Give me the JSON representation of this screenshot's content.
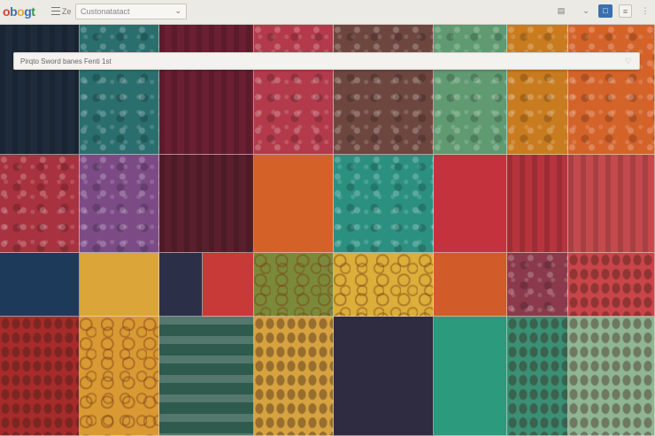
{
  "topbar": {
    "logo_letters": [
      {
        "ch": "o",
        "color": "#d8412f"
      },
      {
        "ch": "b",
        "color": "#3b6ebd"
      },
      {
        "ch": "o",
        "color": "#e9a526"
      },
      {
        "ch": "g",
        "color": "#3b6ebd"
      },
      {
        "ch": "t",
        "color": "#2f9a4c"
      }
    ],
    "label": "Ze",
    "search_text": "Custonatatact",
    "icon_a": "▤",
    "icon_b": "⌄",
    "icon_c": "□",
    "icon_d": "≡",
    "icon_e": "⋮"
  },
  "url_bar": {
    "text": "Pirqto Sword banes Fenti 1st",
    "heart": "♡"
  },
  "mosaic": {
    "tiles": [
      {
        "color": "#1d2b3a",
        "tex": "stripe"
      },
      {
        "color": "#2a6e6e",
        "tex": "speck"
      },
      {
        "color": "#6b1f32",
        "tex": "stripe"
      },
      {
        "color": "#b23a4a",
        "tex": "speck"
      },
      {
        "color": "#6e4640",
        "tex": "speck"
      },
      {
        "color": "#5f9a70",
        "tex": "speck"
      },
      {
        "color": "#c97b1f",
        "tex": "speck"
      },
      {
        "color": "#d4632a",
        "tex": "speck"
      },
      {
        "color": "#a8323f",
        "tex": "speck"
      },
      {
        "color": "#7c4b86",
        "tex": "speck"
      },
      {
        "color": "#5a1f2c",
        "tex": "stripe"
      },
      {
        "color": "#d46127",
        "tex": "none"
      },
      {
        "color": "#2c9081",
        "tex": "speck"
      },
      {
        "color": "#c4323e",
        "tex": "none"
      },
      {
        "color": "#b7343c",
        "tex": "stripe"
      },
      {
        "color": "#c44a4e",
        "tex": "stripe"
      },
      {
        "color": "#1e3a5a",
        "tex": "none"
      },
      {
        "color": "#dba53a",
        "tex": "none"
      },
      {
        "color": "#2c2f48",
        "tex": "none"
      },
      {
        "color": "#c73a38",
        "tex": "none"
      },
      {
        "color": "#7b8a3a",
        "tex": "swirl"
      },
      {
        "color": "#dcae3a",
        "tex": "swirl"
      },
      {
        "color": "#d15c2a",
        "tex": "none"
      },
      {
        "color": "#8a3a4a",
        "tex": "speck"
      },
      {
        "color": "#c8454a",
        "tex": "leaves"
      },
      {
        "color": "#a72b2b",
        "tex": "leaves"
      },
      {
        "color": "#d99a33",
        "tex": "swirl"
      },
      {
        "color": "#2f5a4e",
        "tex": "hstripe"
      },
      {
        "color": "#d6a340",
        "tex": "leaves"
      },
      {
        "color": "#2f2c42",
        "tex": "none"
      },
      {
        "color": "#2c9a7c",
        "tex": "none"
      },
      {
        "color": "#3a8f74",
        "tex": "leaves"
      },
      {
        "color": "#8fb592",
        "tex": "leaves"
      }
    ]
  }
}
